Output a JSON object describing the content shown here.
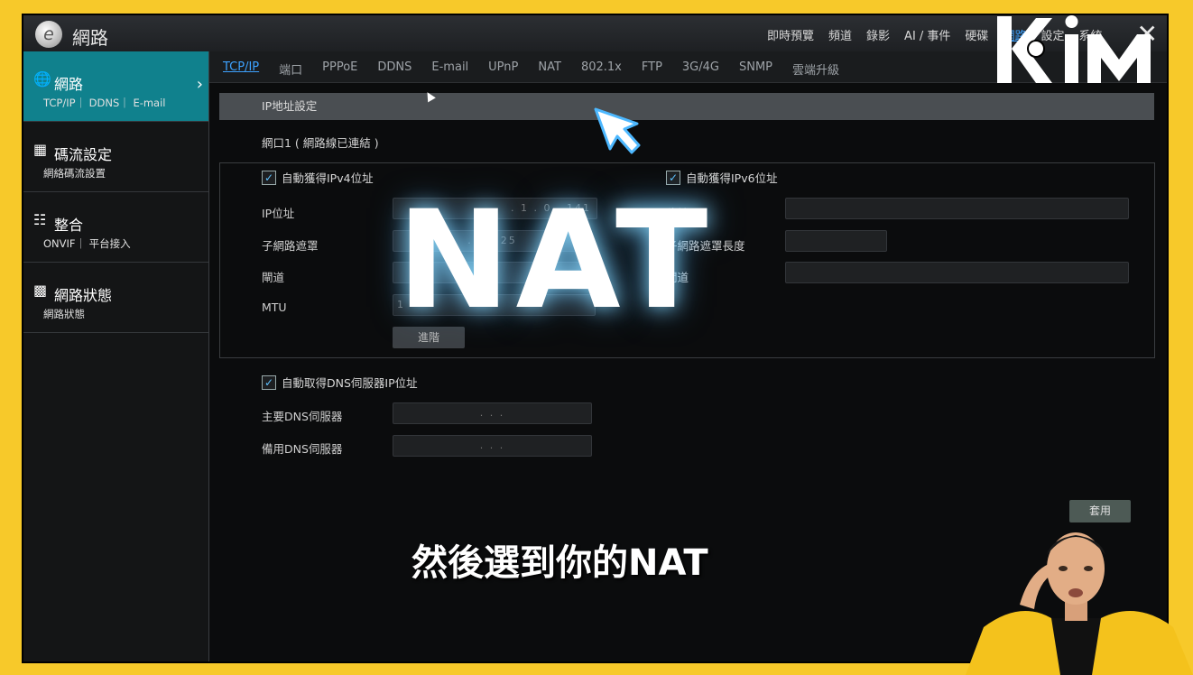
{
  "app": {
    "title": "網路",
    "logo_letter": "e"
  },
  "top_nav": {
    "items": [
      {
        "label": "即時預覽"
      },
      {
        "label": "頻道"
      },
      {
        "label": "錄影"
      },
      {
        "label": "AI / 事件"
      },
      {
        "label": "硬碟"
      },
      {
        "label": "網路"
      },
      {
        "label": "設定"
      },
      {
        "label": "系統"
      }
    ],
    "close_glyph": "✕"
  },
  "sidebar": {
    "items": [
      {
        "title": "網路",
        "sub": "TCP/IP｜ DDNS｜ E-mail",
        "icon": "globe-icon"
      },
      {
        "title": "碼流設定",
        "sub": "網絡碼流設置",
        "icon": "grid-icon"
      },
      {
        "title": "整合",
        "sub": "ONVIF｜ 平台接入",
        "icon": "cluster-icon"
      },
      {
        "title": "網路狀態",
        "sub": "網路狀態",
        "icon": "signal-icon"
      }
    ]
  },
  "subtabs": [
    "TCP/IP",
    "端口",
    "PPPoE",
    "DDNS",
    "E-mail",
    "UPnP",
    "NAT",
    "802.1x",
    "FTP",
    "3G/4G",
    "SNMP",
    "雲端升級"
  ],
  "section": {
    "title": "IP地址設定",
    "port_label": "網口1 ( 網路線已連結 )"
  },
  "ipv4": {
    "checkbox_label": "自動獲得IPv4位址",
    "ip_label": "IP位址",
    "ip_value": ". 1 . 0 . 141",
    "mask_label": "子網路遮罩",
    "mask_value": ". 2 . 25",
    "gateway_label": "閘道",
    "gateway_value": "",
    "mtu_label": "MTU",
    "mtu_value": "1",
    "advanced_label": "進階"
  },
  "ipv6": {
    "checkbox_label": "自動獲得IPv6位址",
    "ip_label": "位址",
    "prefix_label": "子網路遮罩長度",
    "gateway_label": "閘道"
  },
  "dns": {
    "checkbox_label": "自動取得DNS伺服器IP位址",
    "primary_label": "主要DNS伺服器",
    "primary_value": ". . .",
    "secondary_label": "備用DNS伺服器",
    "secondary_value": ". . ."
  },
  "apply_label": "套用",
  "overlay": {
    "big_text": "NAT",
    "caption": "然後選到你的NAT"
  }
}
